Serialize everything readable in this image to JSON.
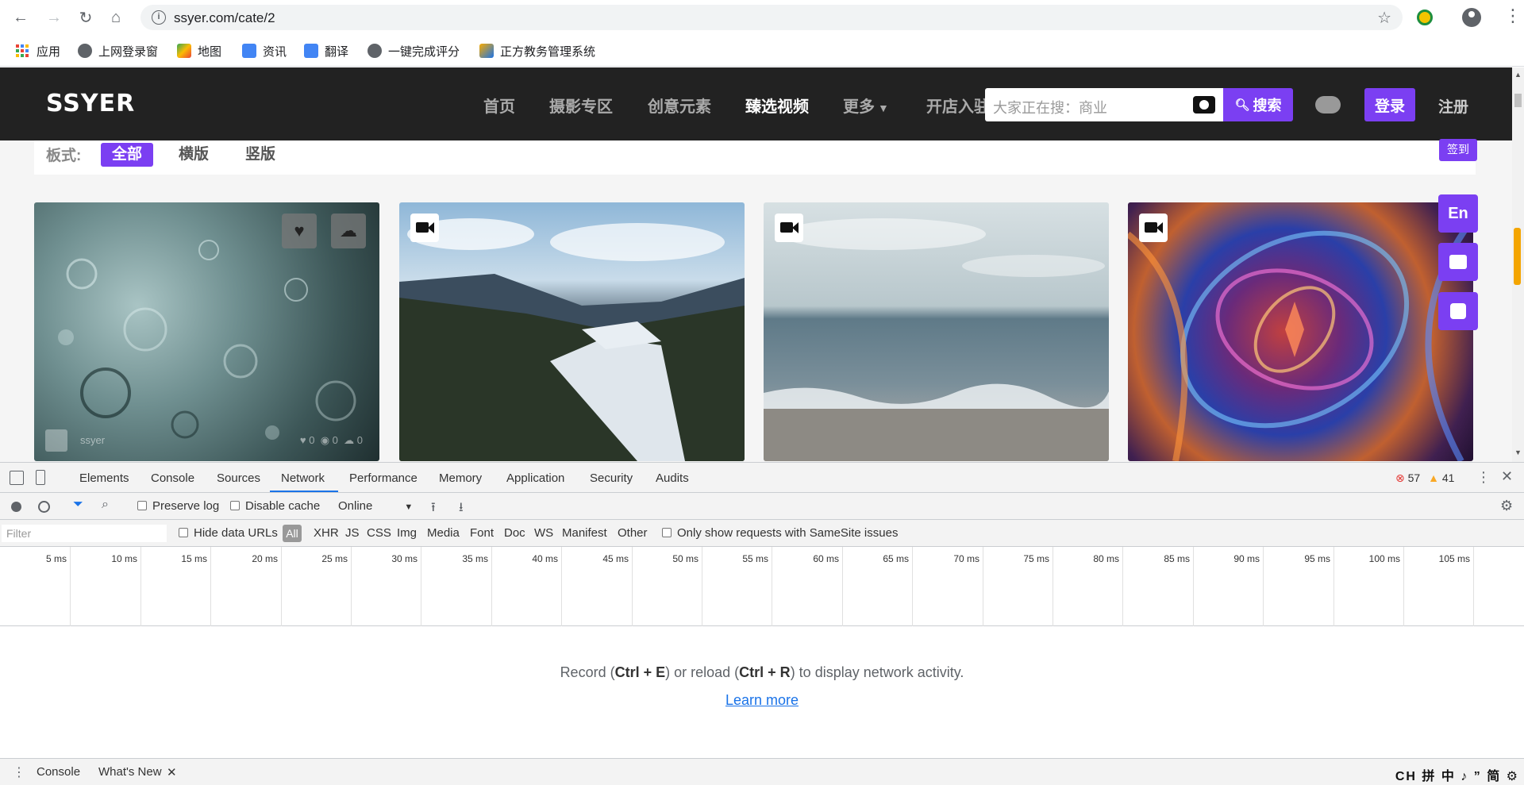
{
  "browser": {
    "url": "ssyer.com/cate/2",
    "bookmarks": [
      {
        "label": "应用",
        "icon": "apps-grid-icon"
      },
      {
        "label": "上网登录窗",
        "icon": "globe-icon"
      },
      {
        "label": "地图",
        "icon": "maps-icon"
      },
      {
        "label": "资讯",
        "icon": "news-icon"
      },
      {
        "label": "翻译",
        "icon": "translate-icon"
      },
      {
        "label": "一键完成评分",
        "icon": "globe-icon"
      },
      {
        "label": "正方教务管理系统",
        "icon": "edu-icon"
      }
    ]
  },
  "site": {
    "logo": "SSYER",
    "nav": [
      "首页",
      "摄影专区",
      "创意元素",
      "臻选视频",
      "更多",
      "开店入驻"
    ],
    "active_nav": "臻选视频",
    "search_placeholder": "大家正在搜：商业",
    "search_button": "搜索",
    "login": "登录",
    "register": "注册",
    "checkin": "签到",
    "filter": {
      "label": "板式:",
      "options": [
        "全部",
        "横版",
        "竖版"
      ],
      "active": "全部"
    },
    "cards": [
      {
        "type": "water-drops",
        "author": "ssyer",
        "likes": "0",
        "views": "0",
        "downloads": "0"
      },
      {
        "type": "forest-valley"
      },
      {
        "type": "sea-shore"
      },
      {
        "type": "fractal"
      }
    ],
    "side_buttons": [
      "En",
      "message-icon",
      "phone-icon"
    ]
  },
  "devtools": {
    "tabs": [
      "Elements",
      "Console",
      "Sources",
      "Network",
      "Performance",
      "Memory",
      "Application",
      "Security",
      "Audits"
    ],
    "active_tab": "Network",
    "errors": "57",
    "warnings": "41",
    "toolbar": {
      "preserve_log": "Preserve log",
      "disable_cache": "Disable cache",
      "throttle": "Online"
    },
    "filterbar": {
      "placeholder": "Filter",
      "hide_data_urls": "Hide data URLs",
      "types": [
        "All",
        "XHR",
        "JS",
        "CSS",
        "Img",
        "Media",
        "Font",
        "Doc",
        "WS",
        "Manifest",
        "Other"
      ],
      "samesite": "Only show requests with SameSite issues"
    },
    "timeline_ticks": [
      "5 ms",
      "10 ms",
      "15 ms",
      "20 ms",
      "25 ms",
      "30 ms",
      "35 ms",
      "40 ms",
      "45 ms",
      "50 ms",
      "55 ms",
      "60 ms",
      "65 ms",
      "70 ms",
      "75 ms",
      "80 ms",
      "85 ms",
      "90 ms",
      "95 ms",
      "100 ms",
      "105 ms"
    ],
    "empty": {
      "record_pre": "Record (",
      "record_key": "Ctrl + E",
      "record_mid": ") or reload (",
      "reload_key": "Ctrl + R",
      "record_post": ") to display network activity.",
      "learn_more": "Learn more"
    },
    "drawer": {
      "tabs": [
        "Console",
        "What's New"
      ]
    },
    "ime": "CH 拼 中 ♪ ” 简 ⚙"
  }
}
